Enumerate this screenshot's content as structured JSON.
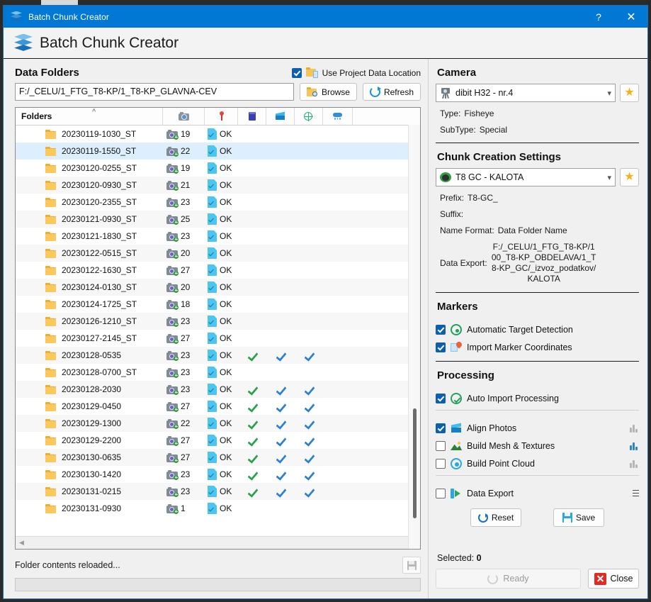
{
  "window": {
    "title": "Batch Chunk Creator",
    "app_icon": "batch-chunk-icon",
    "help_label": "?",
    "close_label": "✕"
  },
  "header": {
    "title": "Batch Chunk Creator"
  },
  "data_folders": {
    "section_title": "Data Folders",
    "use_project_data_location": {
      "label": "Use Project Data Location",
      "checked": true
    },
    "path_value": "F:/_CELU/1_FTG_T8-KP/1_T8-KP_GLAVNA-CEV",
    "browse_label": "Browse",
    "refresh_label": "Refresh",
    "columns": [
      {
        "label": "Folders",
        "icon": ""
      },
      {
        "label": "",
        "icon": "camera-icon"
      },
      {
        "label": "",
        "icon": "map-pin-icon"
      },
      {
        "label": "",
        "icon": "book-icon"
      },
      {
        "label": "",
        "icon": "cube-icon"
      },
      {
        "label": "",
        "icon": "globe-icon"
      },
      {
        "label": "",
        "icon": "point-cloud-icon"
      }
    ],
    "rows": [
      {
        "name": "20230119-1030_ST",
        "count": "19",
        "status": "OK",
        "c1": false,
        "c2": false,
        "c3": false,
        "selected": false
      },
      {
        "name": "20230119-1550_ST",
        "count": "22",
        "status": "OK",
        "c1": false,
        "c2": false,
        "c3": false,
        "selected": true
      },
      {
        "name": "20230120-0255_ST",
        "count": "19",
        "status": "OK",
        "c1": false,
        "c2": false,
        "c3": false,
        "selected": false
      },
      {
        "name": "20230120-0930_ST",
        "count": "21",
        "status": "OK",
        "c1": false,
        "c2": false,
        "c3": false,
        "selected": false
      },
      {
        "name": "20230120-2355_ST",
        "count": "23",
        "status": "OK",
        "c1": false,
        "c2": false,
        "c3": false,
        "selected": false
      },
      {
        "name": "20230121-0930_ST",
        "count": "25",
        "status": "OK",
        "c1": false,
        "c2": false,
        "c3": false,
        "selected": false
      },
      {
        "name": "20230121-1830_ST",
        "count": "23",
        "status": "OK",
        "c1": false,
        "c2": false,
        "c3": false,
        "selected": false
      },
      {
        "name": "20230122-0515_ST",
        "count": "20",
        "status": "OK",
        "c1": false,
        "c2": false,
        "c3": false,
        "selected": false
      },
      {
        "name": "20230122-1630_ST",
        "count": "27",
        "status": "OK",
        "c1": false,
        "c2": false,
        "c3": false,
        "selected": false
      },
      {
        "name": "20230124-0130_ST",
        "count": "20",
        "status": "OK",
        "c1": false,
        "c2": false,
        "c3": false,
        "selected": false
      },
      {
        "name": "20230124-1725_ST",
        "count": "18",
        "status": "OK",
        "c1": false,
        "c2": false,
        "c3": false,
        "selected": false
      },
      {
        "name": "20230126-1210_ST",
        "count": "23",
        "status": "OK",
        "c1": false,
        "c2": false,
        "c3": false,
        "selected": false
      },
      {
        "name": "20230127-2145_ST",
        "count": "27",
        "status": "OK",
        "c1": false,
        "c2": false,
        "c3": false,
        "selected": false
      },
      {
        "name": "20230128-0535",
        "count": "23",
        "status": "OK",
        "c1": true,
        "c2": true,
        "c3": true,
        "selected": false
      },
      {
        "name": "20230128-0700_ST",
        "count": "23",
        "status": "OK",
        "c1": false,
        "c2": false,
        "c3": false,
        "selected": false
      },
      {
        "name": "20230128-2030",
        "count": "23",
        "status": "OK",
        "c1": true,
        "c2": true,
        "c3": true,
        "selected": false
      },
      {
        "name": "20230129-0450",
        "count": "27",
        "status": "OK",
        "c1": true,
        "c2": true,
        "c3": true,
        "selected": false
      },
      {
        "name": "20230129-1300",
        "count": "22",
        "status": "OK",
        "c1": true,
        "c2": true,
        "c3": true,
        "selected": false
      },
      {
        "name": "20230129-2200",
        "count": "27",
        "status": "OK",
        "c1": true,
        "c2": true,
        "c3": true,
        "selected": false
      },
      {
        "name": "20230130-0635",
        "count": "27",
        "status": "OK",
        "c1": true,
        "c2": true,
        "c3": true,
        "selected": false
      },
      {
        "name": "20230130-1420",
        "count": "23",
        "status": "OK",
        "c1": true,
        "c2": true,
        "c3": true,
        "selected": false
      },
      {
        "name": "20230131-0215",
        "count": "23",
        "status": "OK",
        "c1": true,
        "c2": true,
        "c3": true,
        "selected": false
      },
      {
        "name": "20230131-0930",
        "count": "1",
        "status": "OK",
        "c1": false,
        "c2": false,
        "c3": false,
        "selected": false
      }
    ]
  },
  "status": {
    "message": "Folder contents reloaded...",
    "progress_percent": 0
  },
  "camera": {
    "section_title": "Camera",
    "selected": "dibit H32 - nr.4",
    "type_label": "Type:",
    "type_value": "Fisheye",
    "subtype_label": "SubType:",
    "subtype_value": "Special"
  },
  "chunk_settings": {
    "section_title": "Chunk Creation Settings",
    "selected": "T8 GC - KALOTA",
    "prefix_label": "Prefix:",
    "prefix_value": "T8-GC_",
    "suffix_label": "Suffix:",
    "suffix_value": "",
    "name_format_label": "Name Format:",
    "name_format_value": "Data Folder Name",
    "data_export_label": "Data Export:",
    "data_export_value": "F:/_CELU/1_FTG_T8-KP/100_T8-KP_OBDELAVA/1_T8-KP_GC/_izvoz_podatkov/KALOTA"
  },
  "markers": {
    "section_title": "Markers",
    "items": [
      {
        "label": "Automatic Target Detection",
        "checked": true,
        "icon": "target-icon"
      },
      {
        "label": "Import Marker Coordinates",
        "checked": true,
        "icon": "map-marker-icon"
      }
    ]
  },
  "processing": {
    "section_title": "Processing",
    "auto_import": {
      "label": "Auto Import Processing",
      "checked": true,
      "icon": "check-circle-icon"
    },
    "items": [
      {
        "label": "Align Photos",
        "checked": true,
        "icon": "cube-icon",
        "chart_active": false
      },
      {
        "label": "Build Mesh & Textures",
        "checked": false,
        "icon": "mesh-icon",
        "chart_active": true
      },
      {
        "label": "Build Point Cloud",
        "checked": false,
        "icon": "point-cloud-icon",
        "chart_active": false
      }
    ],
    "data_export": {
      "label": "Data Export",
      "checked": false,
      "icon": "export-icon"
    },
    "reset_label": "Reset",
    "save_label": "Save"
  },
  "footer": {
    "selected_label": "Selected:",
    "selected_count": "0",
    "ready_label": "Ready",
    "close_label": "Close"
  },
  "colors": {
    "titlebar": "#0078d4",
    "accent": "#1a6fb5",
    "ok_blue": "#4cc6f0",
    "check_green": "#23a64a",
    "check_blue": "#2b7fd4",
    "star": "#f2b21a",
    "close_red": "#e02b22"
  }
}
